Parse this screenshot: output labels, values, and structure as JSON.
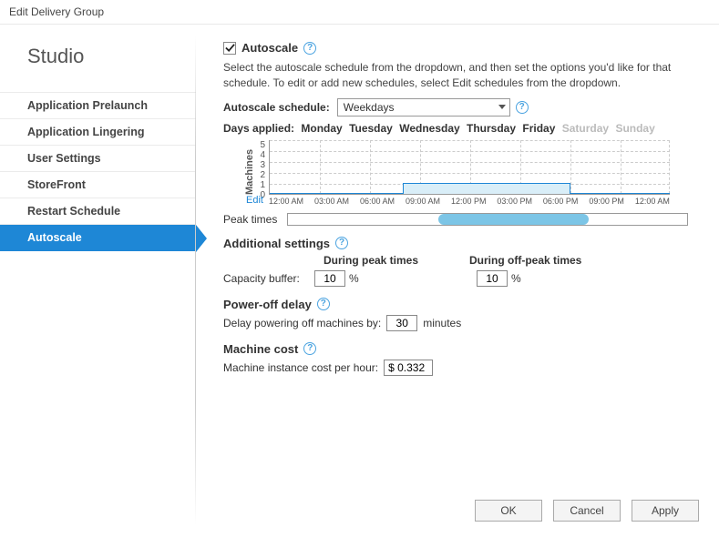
{
  "window": {
    "title": "Edit Delivery Group"
  },
  "sidebar": {
    "brand": "Studio",
    "items": [
      {
        "label": "Application Prelaunch"
      },
      {
        "label": "Application Lingering"
      },
      {
        "label": "User Settings"
      },
      {
        "label": "StoreFront"
      },
      {
        "label": "Restart Schedule"
      },
      {
        "label": "Autoscale"
      }
    ],
    "active_index": 5
  },
  "autoscale": {
    "checkbox_label": "Autoscale",
    "checked": true,
    "description": "Select the autoscale schedule from the dropdown, and then set the options you'd like for that schedule. To edit or add new schedules, select Edit schedules from the dropdown.",
    "schedule_label": "Autoscale schedule:",
    "schedule_value": "Weekdays",
    "days_label": "Days applied:",
    "days": [
      {
        "name": "Monday",
        "on": true
      },
      {
        "name": "Tuesday",
        "on": true
      },
      {
        "name": "Wednesday",
        "on": true
      },
      {
        "name": "Thursday",
        "on": true
      },
      {
        "name": "Friday",
        "on": true
      },
      {
        "name": "Saturday",
        "on": false
      },
      {
        "name": "Sunday",
        "on": false
      }
    ],
    "chart": {
      "y_label": "Machines",
      "y_ticks": [
        "5",
        "4",
        "3",
        "2",
        "1",
        "0"
      ],
      "x_ticks": [
        "12:00 AM",
        "03:00 AM",
        "06:00 AM",
        "09:00 AM",
        "12:00 PM",
        "03:00 PM",
        "06:00 PM",
        "09:00 PM",
        "12:00 AM"
      ],
      "edit_label": "Edit"
    },
    "peak_label": "Peak times",
    "additional_heading": "Additional settings",
    "col_peak": "During peak times",
    "col_offpeak": "During off-peak times",
    "capacity_label": "Capacity buffer:",
    "capacity_peak": "10",
    "capacity_offpeak": "10",
    "pct": "%",
    "poweroff_heading": "Power-off delay",
    "poweroff_label": "Delay powering off machines by:",
    "poweroff_value": "30",
    "poweroff_unit": "minutes",
    "cost_heading": "Machine cost",
    "cost_label": "Machine instance cost per hour:",
    "cost_value": "$ 0.332"
  },
  "chart_data": {
    "type": "area",
    "title": "",
    "xlabel": "",
    "ylabel": "Machines",
    "ylim": [
      0,
      5
    ],
    "x_range_hours": [
      0,
      24
    ],
    "series": [
      {
        "name": "Machines",
        "segments": [
          {
            "from_h": 0,
            "to_h": 8,
            "value": 0
          },
          {
            "from_h": 8,
            "to_h": 18,
            "value": 1
          },
          {
            "from_h": 18,
            "to_h": 24,
            "value": 0
          }
        ]
      }
    ],
    "peak_window_hours": [
      9,
      18
    ]
  },
  "buttons": {
    "ok": "OK",
    "cancel": "Cancel",
    "apply": "Apply"
  }
}
